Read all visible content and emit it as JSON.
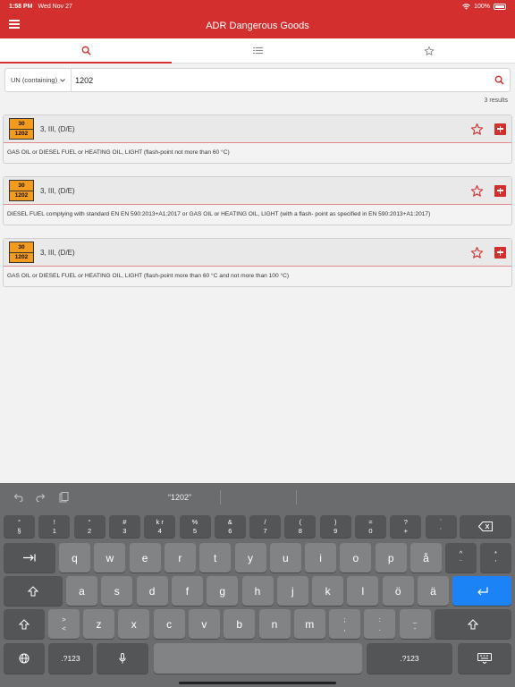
{
  "status_bar": {
    "time": "1:58 PM",
    "date": "Wed Nov 27",
    "battery": "100%"
  },
  "app_bar": {
    "title": "ADR Dangerous Goods"
  },
  "tabs": [
    {
      "name": "search",
      "icon": "search-icon",
      "active": true
    },
    {
      "name": "list",
      "icon": "list-icon",
      "active": false
    },
    {
      "name": "favorites",
      "icon": "star-icon",
      "active": false
    }
  ],
  "search": {
    "filter": "UN (containing)",
    "value": "1202",
    "results_count": "3 results"
  },
  "results": [
    {
      "hazard": "30",
      "un": "1202",
      "class": "3, III, (D/E)",
      "description": "GAS OIL or DIESEL FUEL or HEATING OIL, LIGHT (flash-point not more than 60 °C)"
    },
    {
      "hazard": "30",
      "un": "1202",
      "class": "3, III, (D/E)",
      "description": "DIESEL FUEL complying with standard EN EN 590:2013+A1:2017 or GAS OIL or HEATING OIL, LIGHT (with a flash- point as specified in EN 590:2013+A1:2017)"
    },
    {
      "hazard": "30",
      "un": "1202",
      "class": "3, III, (D/E)",
      "description": "GAS OIL or DIESEL FUEL or HEATING OIL, LIGHT (flash-point more than 60 °C and not more than 100 °C)"
    }
  ],
  "keyboard": {
    "suggestion": "“1202”",
    "number_row": [
      {
        "top": "°",
        "bot": "§"
      },
      {
        "top": "!",
        "bot": "1"
      },
      {
        "top": "“",
        "bot": "2"
      },
      {
        "top": "#",
        "bot": "3"
      },
      {
        "top": "k r",
        "bot": "4"
      },
      {
        "top": "%",
        "bot": "5"
      },
      {
        "top": "&",
        "bot": "6"
      },
      {
        "top": "/",
        "bot": "7"
      },
      {
        "top": "(",
        "bot": "8"
      },
      {
        "top": ")",
        "bot": "9"
      },
      {
        "top": "=",
        "bot": "0"
      },
      {
        "top": "?",
        "bot": "+"
      },
      {
        "top": "`",
        "bot": "´"
      }
    ],
    "row1": [
      "q",
      "w",
      "e",
      "r",
      "t",
      "y",
      "u",
      "i",
      "o",
      "p",
      "å"
    ],
    "row1_extra": [
      {
        "top": "^",
        "bot": "¨"
      },
      {
        "top": "*",
        "bot": "'"
      }
    ],
    "row2": [
      "a",
      "s",
      "d",
      "f",
      "g",
      "h",
      "j",
      "k",
      "l",
      "ö",
      "ä"
    ],
    "row3_left": {
      "top": ">",
      "bot": "<"
    },
    "row3": [
      "z",
      "x",
      "c",
      "v",
      "b",
      "n",
      "m"
    ],
    "row3_punct": [
      {
        "top": ";",
        "bot": ","
      },
      {
        "top": ":",
        "bot": "."
      },
      {
        "top": "_",
        "bot": "-"
      }
    ],
    "numbers_label": ".?123",
    "colors": {
      "accent": "#d32f2f",
      "plate": "#f49b1e",
      "return_key": "#1c83f7"
    }
  }
}
